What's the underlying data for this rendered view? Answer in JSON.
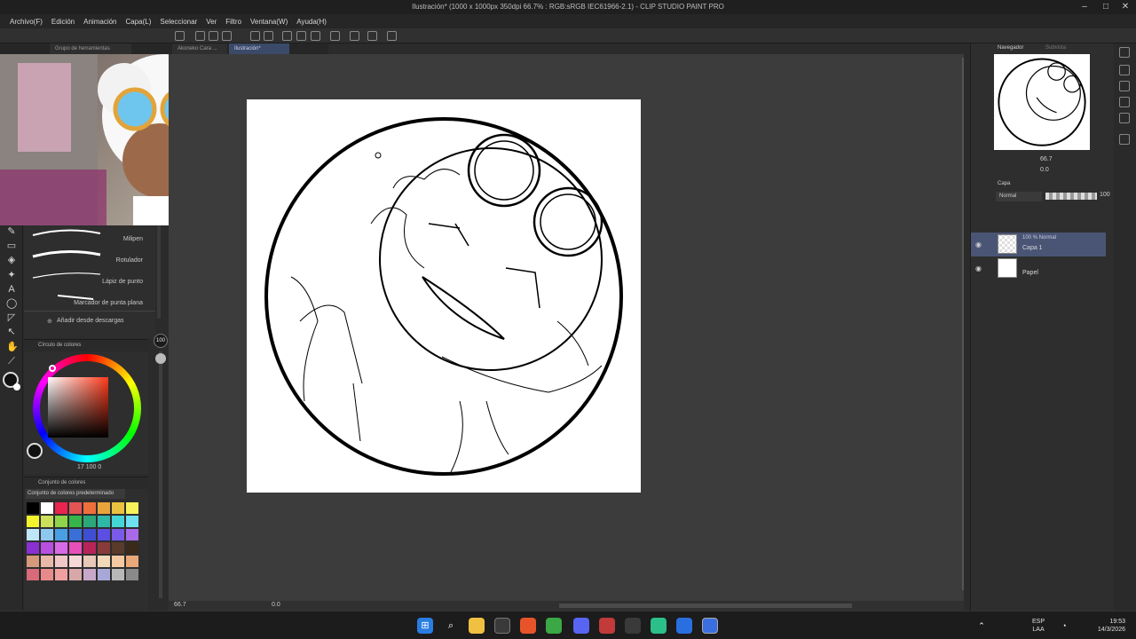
{
  "window": {
    "title": "Ilustración* (1000 x 1000px 350dpi 66.7% : RGB:sRGB IEC61966-2.1) - CLIP STUDIO PAINT PRO"
  },
  "menu": [
    "Archivo(F)",
    "Edición",
    "Animación",
    "Capa(L)",
    "Seleccionar",
    "Ver",
    "Filtro",
    "Ventana(W)",
    "Ayuda(H)"
  ],
  "tabs": {
    "tool_group": "Grupo de herramientas",
    "doc1": "Akoneko Cara ...",
    "doc2": "Ilustración*"
  },
  "subtool": {
    "brushes": [
      "Milipen",
      "Rotulador",
      "Lápiz de punto",
      "Marcador de punta plana"
    ],
    "add_label": "Añadir desde descargas"
  },
  "brush_size": {
    "value": "100"
  },
  "color_wheel": {
    "header": "Círculo de colores",
    "readout": "17  100  0"
  },
  "color_set": {
    "header": "Conjunto de colores",
    "selected": "Conjunto de colores predeterminado",
    "swatches": [
      "#000000",
      "#ffffff",
      "#e8244f",
      "#e35454",
      "#ef6f3b",
      "#e8a33b",
      "#eac23f",
      "#f8f25a",
      "#f4f42e",
      "#cde05c",
      "#8fd44a",
      "#37b54a",
      "#2aa87a",
      "#2eb8a8",
      "#44d6d6",
      "#6fe0f0",
      "#bfe6f8",
      "#8ec7ef",
      "#4a9ee3",
      "#3a6fd8",
      "#3f4fd4",
      "#5a4fe0",
      "#7a5ae8",
      "#a86ae8",
      "#8a2fd0",
      "#b84fe0",
      "#d86ae8",
      "#e84fb8",
      "#b8245a",
      "#8a3a3a",
      "#5a3a2a",
      "#3a2a1a",
      "#d49a7a",
      "#e8b8a8",
      "#f0c8c8",
      "#f4d8d8",
      "#e8c8b8",
      "#f0d8b8",
      "#f4c8a0",
      "#e8a878",
      "#d86a7a",
      "#e88a8a",
      "#f0a0a0",
      "#d8a8a8",
      "#c8a8c8",
      "#a8a8d8",
      "#b8b8b8",
      "#8a8a8a"
    ]
  },
  "canvas": {
    "zoom": "66.7",
    "angle": "0.0"
  },
  "navigator": {
    "header": "Navegador",
    "alt_tab": "Subvista",
    "zoom": "66.7",
    "angle": "0.0"
  },
  "layers": {
    "header": "Capa",
    "blend_mode": "Normal",
    "opacity": "100",
    "items": [
      {
        "mode": "100 % Normal",
        "name": "Capa 1",
        "selected": true
      },
      {
        "mode": "",
        "name": "Papel",
        "selected": false
      }
    ]
  },
  "taskbar": {
    "lang_top": "ESP",
    "lang_bottom": "LAA",
    "time": "19:53",
    "date": "14/3/2026"
  },
  "colors": {
    "accent": "#3b4a68",
    "panel": "#2e2e2e",
    "canvas_bg": "#3c3c3c"
  }
}
